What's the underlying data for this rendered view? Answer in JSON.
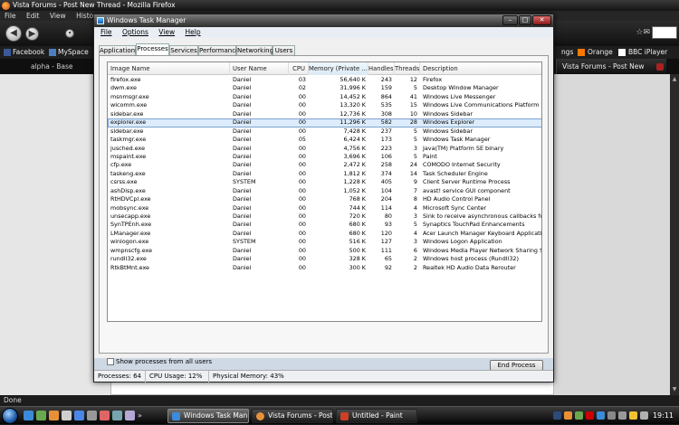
{
  "firefox": {
    "title": "Vista Forums - Post New Thread - Mozilla Firefox",
    "menu": [
      "File",
      "Edit",
      "View",
      "History"
    ],
    "bookmarks": [
      "Facebook",
      "MySpace"
    ],
    "bookmarks_right": [
      "ngs",
      "Orange",
      "BBC iPlayer"
    ],
    "tab_left": "alpha - Base",
    "tab_right": "Vista Forums - Post New Thread",
    "status": "Done"
  },
  "taskmgr": {
    "title": "Windows Task Manager",
    "menu": [
      "File",
      "Options",
      "View",
      "Help"
    ],
    "tabs": [
      "Applications",
      "Processes",
      "Services",
      "Performance",
      "Networking",
      "Users"
    ],
    "active_tab": "Processes",
    "columns": [
      "Image Name",
      "User Name",
      "CPU",
      "Memory (Private ...",
      "Handles",
      "Threads",
      "Description"
    ],
    "processes": [
      {
        "name": "firefox.exe",
        "user": "Daniel",
        "cpu": "03",
        "mem": "56,640 K",
        "handles": "243",
        "threads": "12",
        "desc": "Firefox"
      },
      {
        "name": "dwm.exe",
        "user": "Daniel",
        "cpu": "02",
        "mem": "31,996 K",
        "handles": "159",
        "threads": "5",
        "desc": "Desktop Window Manager"
      },
      {
        "name": "msnmsgr.exe",
        "user": "Daniel",
        "cpu": "00",
        "mem": "14,452 K",
        "handles": "864",
        "threads": "41",
        "desc": "Windows Live Messenger"
      },
      {
        "name": "wlcomm.exe",
        "user": "Daniel",
        "cpu": "00",
        "mem": "13,320 K",
        "handles": "535",
        "threads": "15",
        "desc": "Windows Live Communications Platform"
      },
      {
        "name": "sidebar.exe",
        "user": "Daniel",
        "cpu": "00",
        "mem": "12,736 K",
        "handles": "308",
        "threads": "10",
        "desc": "Windows Sidebar"
      },
      {
        "name": "explorer.exe",
        "user": "Daniel",
        "cpu": "00",
        "mem": "11,296 K",
        "handles": "582",
        "threads": "28",
        "desc": "Windows Explorer",
        "selected": true
      },
      {
        "name": "sidebar.exe",
        "user": "Daniel",
        "cpu": "00",
        "mem": "7,428 K",
        "handles": "237",
        "threads": "5",
        "desc": "Windows Sidebar"
      },
      {
        "name": "taskmgr.exe",
        "user": "Daniel",
        "cpu": "05",
        "mem": "6,424 K",
        "handles": "173",
        "threads": "5",
        "desc": "Windows Task Manager"
      },
      {
        "name": "jusched.exe",
        "user": "Daniel",
        "cpu": "00",
        "mem": "4,756 K",
        "handles": "223",
        "threads": "3",
        "desc": "Java(TM) Platform SE binary"
      },
      {
        "name": "mspaint.exe",
        "user": "Daniel",
        "cpu": "00",
        "mem": "3,696 K",
        "handles": "106",
        "threads": "5",
        "desc": "Paint"
      },
      {
        "name": "cfp.exe",
        "user": "Daniel",
        "cpu": "00",
        "mem": "2,472 K",
        "handles": "258",
        "threads": "24",
        "desc": "COMODO Internet Security"
      },
      {
        "name": "taskeng.exe",
        "user": "Daniel",
        "cpu": "00",
        "mem": "1,812 K",
        "handles": "374",
        "threads": "14",
        "desc": "Task Scheduler Engine"
      },
      {
        "name": "csrss.exe",
        "user": "SYSTEM",
        "cpu": "00",
        "mem": "1,228 K",
        "handles": "405",
        "threads": "9",
        "desc": "Client Server Runtime Process"
      },
      {
        "name": "ashDisp.exe",
        "user": "Daniel",
        "cpu": "00",
        "mem": "1,052 K",
        "handles": "104",
        "threads": "7",
        "desc": "avast! service GUI component"
      },
      {
        "name": "RtHDVCpl.exe",
        "user": "Daniel",
        "cpu": "00",
        "mem": "768 K",
        "handles": "204",
        "threads": "8",
        "desc": "HD Audio Control Panel"
      },
      {
        "name": "mobsync.exe",
        "user": "Daniel",
        "cpu": "00",
        "mem": "744 K",
        "handles": "114",
        "threads": "4",
        "desc": "Microsoft Sync Center"
      },
      {
        "name": "unsecapp.exe",
        "user": "Daniel",
        "cpu": "00",
        "mem": "720 K",
        "handles": "80",
        "threads": "3",
        "desc": "Sink to receive asynchronous callbacks for WMI"
      },
      {
        "name": "SynTPEnh.exe",
        "user": "Daniel",
        "cpu": "00",
        "mem": "680 K",
        "handles": "93",
        "threads": "5",
        "desc": "Synaptics TouchPad Enhancements"
      },
      {
        "name": "LManager.exe",
        "user": "Daniel",
        "cpu": "00",
        "mem": "680 K",
        "handles": "120",
        "threads": "4",
        "desc": "Acer Launch Manager Keyboard Application"
      },
      {
        "name": "winlogon.exe",
        "user": "SYSTEM",
        "cpu": "00",
        "mem": "516 K",
        "handles": "127",
        "threads": "3",
        "desc": "Windows Logon Application"
      },
      {
        "name": "wmpnscfg.exe",
        "user": "Daniel",
        "cpu": "00",
        "mem": "500 K",
        "handles": "111",
        "threads": "6",
        "desc": "Windows Media Player Network Sharing Service"
      },
      {
        "name": "rundll32.exe",
        "user": "Daniel",
        "cpu": "00",
        "mem": "328 K",
        "handles": "65",
        "threads": "2",
        "desc": "Windows host process (Rundll32)"
      },
      {
        "name": "RtkBtMnt.exe",
        "user": "Daniel",
        "cpu": "00",
        "mem": "300 K",
        "handles": "92",
        "threads": "2",
        "desc": "Realtek HD Audio Data Rerouter"
      }
    ],
    "show_all_label": "Show processes from all users",
    "end_process_label": "End Process",
    "status": {
      "processes": "Processes: 64",
      "cpu": "CPU Usage: 12%",
      "memory": "Physical Memory: 43%"
    }
  },
  "taskbar": {
    "tasks": [
      "Windows Task Man...",
      "Vista Forums - Post ...",
      "Untitled - Paint"
    ],
    "clock": "19:11"
  },
  "colors": {
    "selection": "#dcecfc",
    "accent": "#1e5aa8"
  }
}
